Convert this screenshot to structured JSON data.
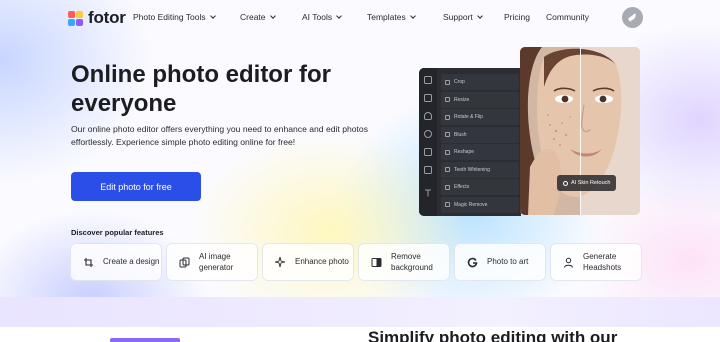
{
  "nav": {
    "logo": "fotor",
    "items": [
      {
        "label": "Photo Editing Tools",
        "dropdown": true
      },
      {
        "label": "Create",
        "dropdown": true
      },
      {
        "label": "AI Tools",
        "dropdown": true
      },
      {
        "label": "Templates",
        "dropdown": true
      },
      {
        "label": "Support",
        "dropdown": true
      },
      {
        "label": "Pricing",
        "dropdown": false
      },
      {
        "label": "Community",
        "dropdown": false
      }
    ],
    "avatar_icon": "bird-icon"
  },
  "hero": {
    "title": "Online photo editor for everyone",
    "subtitle": "Our online photo editor offers everything you need to enhance and edit photos effortlessly. Experience simple photo editing online for free!",
    "cta": "Edit photo for free",
    "discover": "Discover popular features"
  },
  "features": [
    {
      "label": "Create a design",
      "icon": "crop-icon"
    },
    {
      "label": "AI image generator",
      "icon": "layers-icon"
    },
    {
      "label": "Enhance photo",
      "icon": "sparkle-icon"
    },
    {
      "label": "Remove background",
      "icon": "cutout-icon"
    },
    {
      "label": "Photo to art",
      "icon": "g-icon"
    },
    {
      "label": "Generate Headshots",
      "icon": "person-icon"
    }
  ],
  "editor": {
    "tools": [
      "Crop",
      "Resize",
      "Rotate & Flip",
      "Blush",
      "Reshape",
      "Teeth Whitening",
      "Effects",
      "Magic Remove"
    ],
    "badge": "AI Skin Retouch"
  },
  "section2": {
    "heading": "Simplify photo editing with our"
  },
  "colors": {
    "primary": "#2c4ee8",
    "text": "#1c1d21",
    "editor_bg": "#2b2d33",
    "logo": [
      "#ff5a5f",
      "#ffc83d",
      "#3aa6ff",
      "#8b5cf6"
    ]
  }
}
